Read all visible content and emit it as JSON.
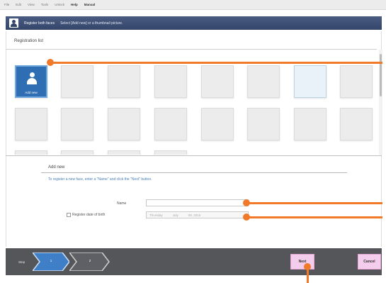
{
  "menu": [
    "File",
    "Edit",
    "View",
    "Tools",
    "Unlock",
    "Help",
    "Manual"
  ],
  "title": {
    "app": "Register both faces",
    "instruction": "Select [Add new] or a thumbnail picture."
  },
  "registration_list": {
    "header": "Registration list",
    "add_new_label": "Add new"
  },
  "add_new": {
    "title": "Add new",
    "instruction": "To register a new face, enter a \"Name\" and click the \"Next\" button.",
    "name_label": "Name",
    "name_value": "",
    "dob_label": "Register date of birth",
    "dob_checked": false,
    "dob_value": {
      "weekday": "Thursday",
      "month": "July",
      "day_year": "09, 2015"
    }
  },
  "steps": {
    "label": "Step",
    "items": [
      "1",
      "2"
    ]
  },
  "buttons": {
    "next": "Next",
    "cancel": "Cancel"
  },
  "colors": {
    "accent": "#f07a2a",
    "header": "#34456a",
    "button": "#f3cdeb",
    "step": "#3f7fc8"
  }
}
